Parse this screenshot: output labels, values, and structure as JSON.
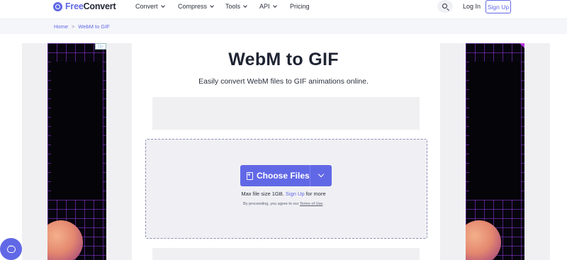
{
  "header": {
    "logo_free": "Free",
    "logo_convert": "Convert",
    "nav": [
      {
        "label": "Convert",
        "has_dropdown": true
      },
      {
        "label": "Compress",
        "has_dropdown": true
      },
      {
        "label": "Tools",
        "has_dropdown": true
      },
      {
        "label": "API",
        "has_dropdown": true
      },
      {
        "label": "Pricing",
        "has_dropdown": false
      }
    ],
    "login_label": "Log In",
    "signup_label": "Sign Up"
  },
  "breadcrumb": {
    "home": "Home",
    "separator": ">",
    "current": "WebM to GIF"
  },
  "main": {
    "title": "WebM to GIF",
    "subtitle": "Easily convert WebM files to GIF animations online.",
    "choose_files_label": "Choose Files",
    "max_size_prefix": "Max file size 1GB.",
    "max_size_link": "Sign Up",
    "max_size_suffix": "for more",
    "terms_prefix": "By proceeding, you agree to our",
    "terms_link": "Terms of Use",
    "terms_suffix": "."
  },
  "ads": {
    "badge": "i ▷"
  },
  "colors": {
    "brand": "#6168e6",
    "text": "#1f2433",
    "dropzone_bg": "#f0f0f4"
  },
  "icons": {
    "logo": "freeconvert-logo-icon",
    "search": "search-icon",
    "file": "file-plus-icon",
    "dropdown": "chevron-down-icon",
    "chat": "chat-bubble-icon"
  }
}
